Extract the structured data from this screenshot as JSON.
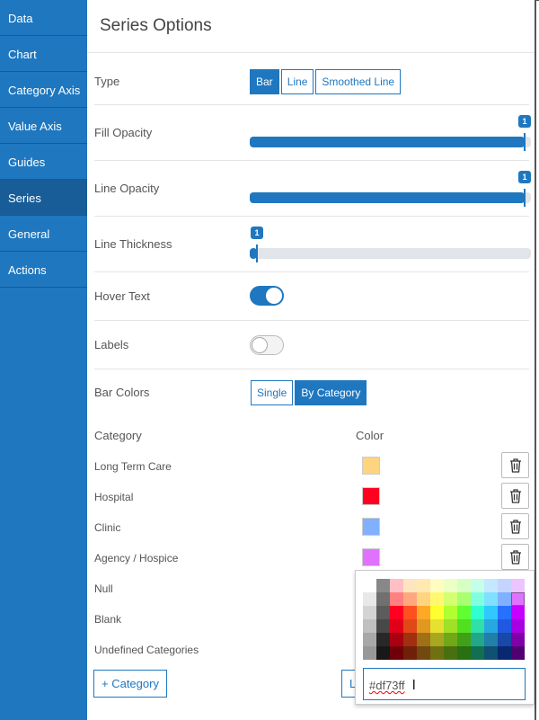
{
  "sidebar": {
    "items": [
      {
        "label": "Data"
      },
      {
        "label": "Chart"
      },
      {
        "label": "Category Axis"
      },
      {
        "label": "Value Axis"
      },
      {
        "label": "Guides"
      },
      {
        "label": "Series",
        "active": true
      },
      {
        "label": "General"
      },
      {
        "label": "Actions"
      }
    ]
  },
  "title": "Series Options",
  "type": {
    "label": "Type",
    "options": [
      "Bar",
      "Line",
      "Smoothed Line"
    ],
    "selected": "Bar"
  },
  "fill_opacity": {
    "label": "Fill Opacity",
    "value": "1",
    "fraction": 1
  },
  "line_opacity": {
    "label": "Line Opacity",
    "value": "1",
    "fraction": 1
  },
  "line_thickness": {
    "label": "Line Thickness",
    "value": "1",
    "fraction": 0
  },
  "hover_text": {
    "label": "Hover Text",
    "on": true
  },
  "labels": {
    "label": "Labels",
    "on": false
  },
  "bar_colors": {
    "label": "Bar Colors",
    "options": [
      "Single",
      "By Category"
    ],
    "selected": "By Category"
  },
  "table": {
    "category_header": "Category",
    "color_header": "Color",
    "rows": [
      {
        "name": "Long Term Care",
        "color": "#ffd480"
      },
      {
        "name": "Hospital",
        "color": "#ff0020"
      },
      {
        "name": "Clinic",
        "color": "#80b0ff"
      },
      {
        "name": "Agency / Hospice",
        "color": "#df73ff"
      },
      {
        "name": "Null"
      },
      {
        "name": "Blank"
      },
      {
        "name": "Undefined Categories"
      }
    ]
  },
  "add_category_label": "+ Category",
  "hidden_button_label": "L",
  "picker": {
    "value": "#df73ff",
    "palette": [
      [
        "#ffffff",
        "#888888",
        "#ffbfc4",
        "#ffe4c0",
        "#ffe9b0",
        "#fffcc0",
        "#ecffc4",
        "#d6ffc4",
        "#c4ffe8",
        "#c4e8ff",
        "#c4d4ff",
        "#ecc4ff"
      ],
      [
        "#e8e8e8",
        "#707070",
        "#ff8080",
        "#ffa880",
        "#ffd480",
        "#fff870",
        "#d4ff70",
        "#a8ff70",
        "#80ffe0",
        "#80e0ff",
        "#80b0ff",
        "#df73ff"
      ],
      [
        "#d4d4d4",
        "#5c5c5c",
        "#ff0020",
        "#ff5020",
        "#ffa828",
        "#ffff30",
        "#b0ff30",
        "#60ff30",
        "#30ffd0",
        "#30c8ff",
        "#2870ff",
        "#c800ff"
      ],
      [
        "#c0c0c0",
        "#484848",
        "#e00018",
        "#e04818",
        "#e09820",
        "#e8e030",
        "#a0e028",
        "#50e020",
        "#30e0a8",
        "#28a8e0",
        "#2058e0",
        "#a800e0"
      ],
      [
        "#a8a8a8",
        "#282828",
        "#a80010",
        "#a03010",
        "#a07018",
        "#a8a820",
        "#70a818",
        "#40a018",
        "#20a888",
        "#2080a8",
        "#1848a8",
        "#8000a8"
      ],
      [
        "#989898",
        "#181818",
        "#700008",
        "#702008",
        "#704810",
        "#707010",
        "#487010",
        "#287010",
        "#107050",
        "#105070",
        "#082870",
        "#500070"
      ]
    ]
  },
  "colors": {
    "accent": "#1f77bf",
    "sidebar_active": "#185d97"
  }
}
